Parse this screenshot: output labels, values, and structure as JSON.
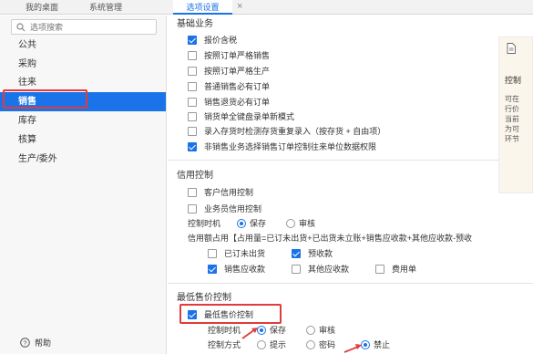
{
  "tabs": [
    {
      "label": "我的桌面"
    },
    {
      "label": "系统管理"
    },
    {
      "label": "选项设置",
      "active": true
    }
  ],
  "tab_close": "×",
  "sidebar": {
    "search_placeholder": "选项搜索",
    "items": [
      "公共",
      "采购",
      "往来",
      "销售",
      "库存",
      "核算",
      "生产/委外"
    ],
    "active_index": 3,
    "help_label": "帮助"
  },
  "basic": {
    "title": "基础业务",
    "options": [
      {
        "label": "报价含税",
        "checked": true
      },
      {
        "label": "按照订单严格销售",
        "checked": false
      },
      {
        "label": "按照订单严格生产",
        "checked": false
      },
      {
        "label": "普通销售必有订单",
        "checked": false
      },
      {
        "label": "销售退货必有订单",
        "checked": false
      },
      {
        "label": "销货单全键盘录单新模式",
        "checked": false
      },
      {
        "label": "录入存货时检测存货重复录入（按存货 + 自由项）",
        "checked": false
      },
      {
        "label": "非销售业务选择销售订单控制往来单位数据权限",
        "checked": true
      }
    ]
  },
  "credit": {
    "title": "信用控制",
    "customer_credit": "客户信用控制",
    "salesman_credit": "业务员信用控制",
    "control_time_label": "控制时机",
    "save_label": "保存",
    "audit_label": "审核",
    "formula": "信用额占用【占用量=已订未出货+已出货未立账+销售应收款+其他应收款-预收",
    "occupy_items": [
      {
        "label": "已订未出货",
        "checked": false
      },
      {
        "label": "预收款",
        "checked": true
      },
      {
        "label": "销售应收款",
        "checked": true
      },
      {
        "label": "其他应收款",
        "checked": false
      },
      {
        "label": "费用单",
        "checked": false
      }
    ]
  },
  "minprice": {
    "title": "最低售价控制",
    "checkbox_label": "最低售价控制",
    "control_time_label": "控制时机",
    "save_label": "保存",
    "audit_label": "审核",
    "control_mode_label": "控制方式",
    "prompt_label": "提示",
    "password_label": "密码",
    "forbid_label": "禁止"
  },
  "side_card": {
    "title": "控制",
    "lines": [
      "可在",
      "行价",
      "当前",
      "为可",
      "环节"
    ]
  },
  "colors": {
    "accent": "#1a73e8",
    "highlight": "#e23b3b"
  }
}
